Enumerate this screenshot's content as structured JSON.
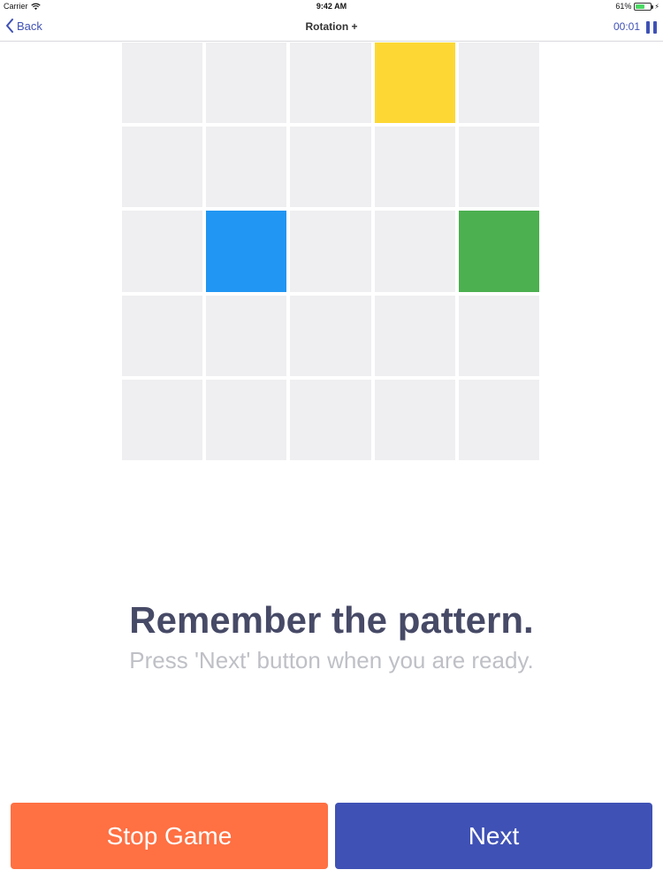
{
  "status_bar": {
    "carrier": "Carrier",
    "time": "9:42 AM",
    "battery": "61%",
    "battery_level": 0.61,
    "battery_color": "#4cd964"
  },
  "nav": {
    "back_label": "Back",
    "title": "Rotation +",
    "timer": "00:01",
    "accent_color": "#3f51b5"
  },
  "grid": {
    "rows": 5,
    "cols": 5,
    "empty_color": "#efeff1",
    "filled": [
      {
        "row": 0,
        "col": 3,
        "color": "#fdd835"
      },
      {
        "row": 2,
        "col": 1,
        "color": "#2196f3"
      },
      {
        "row": 2,
        "col": 4,
        "color": "#4caf50"
      }
    ]
  },
  "message": {
    "headline": "Remember the pattern.",
    "subline": "Press 'Next' button when you are ready."
  },
  "buttons": {
    "stop": {
      "label": "Stop Game",
      "color": "#ff7043"
    },
    "next": {
      "label": "Next",
      "color": "#3f51b5"
    }
  }
}
